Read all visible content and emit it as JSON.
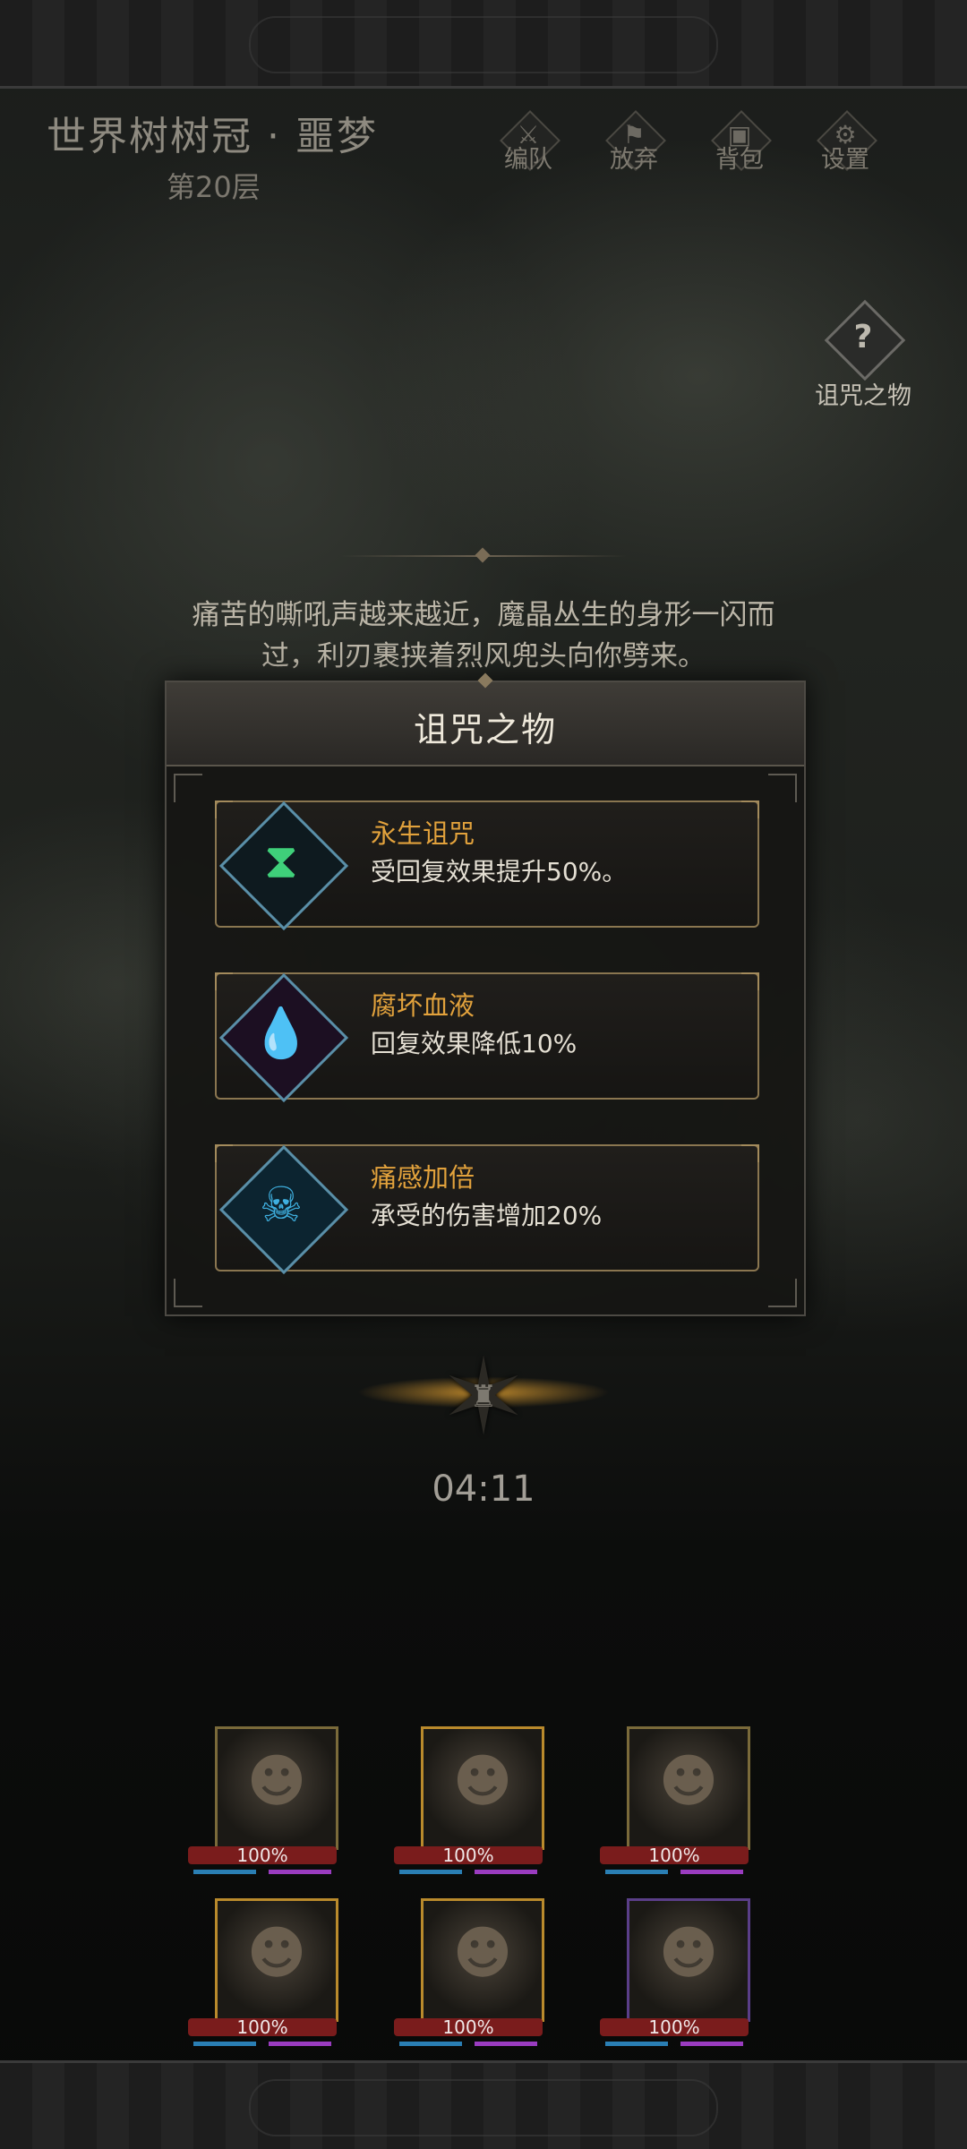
{
  "header": {
    "title": "世界树树冠 · 噩梦",
    "floor": "第20层",
    "buttons": [
      {
        "label": "编队",
        "icon": "formation-icon"
      },
      {
        "label": "放弃",
        "icon": "flag-icon"
      },
      {
        "label": "背包",
        "icon": "backpack-icon"
      },
      {
        "label": "设置",
        "icon": "gear-icon"
      }
    ]
  },
  "side": {
    "curse_label": "诅咒之物",
    "curse_icon": "question-icon"
  },
  "dialog": {
    "text_line1": "痛苦的嘶吼声越来越近，魔晶丛生的身形一闪而",
    "text_line2": "过，利刃裹挟着烈风兜头向你劈来。"
  },
  "panel": {
    "title": "诅咒之物",
    "items": [
      {
        "name": "永生诅咒",
        "desc": "受回复效果提升50%。",
        "icon": "hourglass-icon"
      },
      {
        "name": "腐坏血液",
        "desc": "回复效果降低10%",
        "icon": "blood-drops-icon"
      },
      {
        "name": "痛感加倍",
        "desc": "承受的伤害增加20%",
        "icon": "pain-silhouette-icon"
      }
    ]
  },
  "timer": "04:11",
  "team": [
    {
      "hp": "100%",
      "hp_fraction": 1.0
    },
    {
      "hp": "100%",
      "hp_fraction": 1.0
    },
    {
      "hp": "100%",
      "hp_fraction": 1.0
    },
    {
      "hp": "100%",
      "hp_fraction": 1.0
    },
    {
      "hp": "100%",
      "hp_fraction": 1.0
    },
    {
      "hp": "100%",
      "hp_fraction": 1.0
    }
  ],
  "colors": {
    "accent_gold": "#e2a23c",
    "hp_red": "#7a1c1c",
    "mana_blue": "#2a7fb4"
  }
}
